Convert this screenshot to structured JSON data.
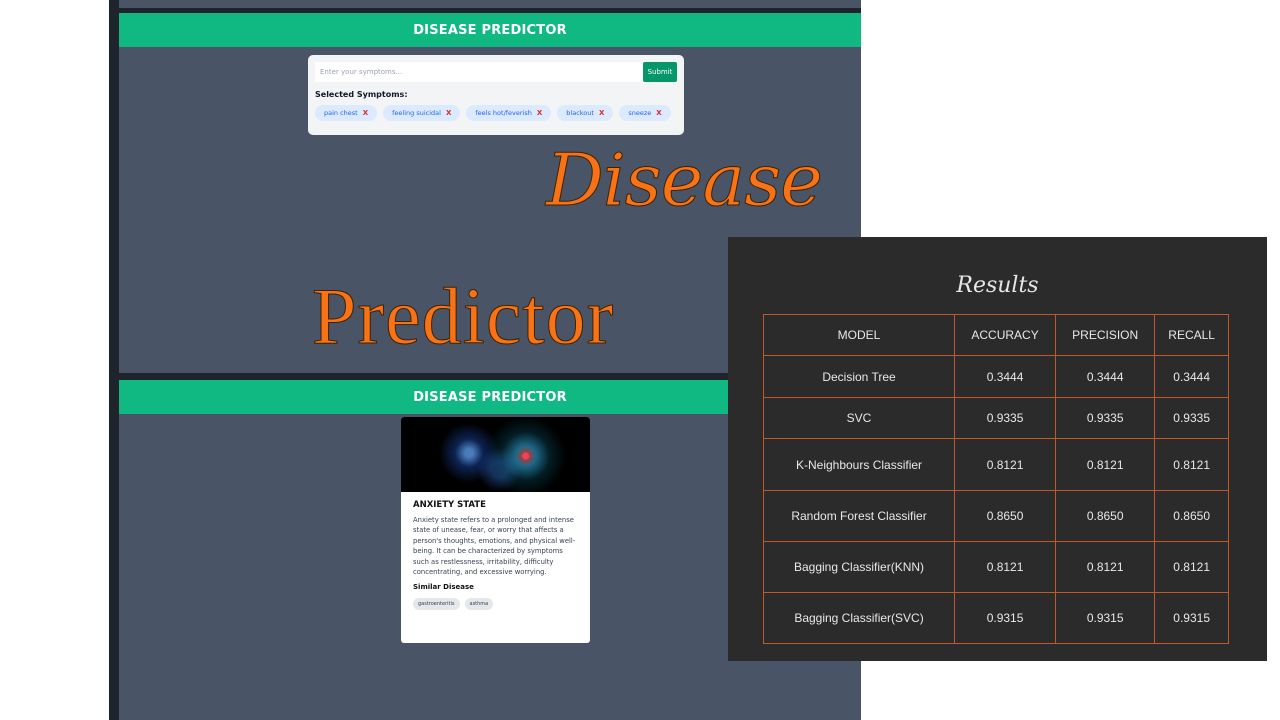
{
  "app": {
    "header_title": "DISEASE PREDICTOR"
  },
  "symptom_form": {
    "input_placeholder": "Enter your symptoms...",
    "submit_label": "Submit",
    "selected_heading": "Selected Symptoms:",
    "remove_label": "X",
    "chips": [
      "pain chest",
      "feeling suicidal",
      "feels hot/feverish",
      "blackout",
      "sneeze"
    ]
  },
  "overlay_title": {
    "line1": "Disease",
    "line2": "Predictor"
  },
  "disease_card": {
    "title": "ANXIETY STATE",
    "description": "Anxiety state refers to a prolonged and intense state of unease, fear, or worry that affects a person's thoughts, emotions, and physical well-being. It can be characterized by symptoms such as restlessness, irritability, difficulty concentrating, and excessive worrying.",
    "similar_heading": "Similar Disease",
    "similar": [
      "gastroenteritis",
      "asthma"
    ]
  },
  "results": {
    "title": "Results",
    "columns": [
      "MODEL",
      "ACCURACY",
      "PRECISION",
      "RECALL"
    ],
    "rows": [
      [
        "Decision Tree",
        "0.3444",
        "0.3444",
        "0.3444"
      ],
      [
        "SVC",
        "0.9335",
        "0.9335",
        "0.9335"
      ],
      [
        "K-Neighbours Classifier",
        "0.8121",
        "0.8121",
        "0.8121"
      ],
      [
        "Random Forest Classifier",
        "0.8650",
        "0.8650",
        "0.8650"
      ],
      [
        "Bagging Classifier(KNN)",
        "0.8121",
        "0.8121",
        "0.8121"
      ],
      [
        "Bagging Classifier(SVC)",
        "0.9315",
        "0.9315",
        "0.9315"
      ]
    ]
  },
  "colors": {
    "header_green": "#10b981",
    "page_slate": "#4a5467",
    "title_orange": "#f97316",
    "table_border": "#c0582a",
    "panel_bg": "#2b2b2b"
  }
}
